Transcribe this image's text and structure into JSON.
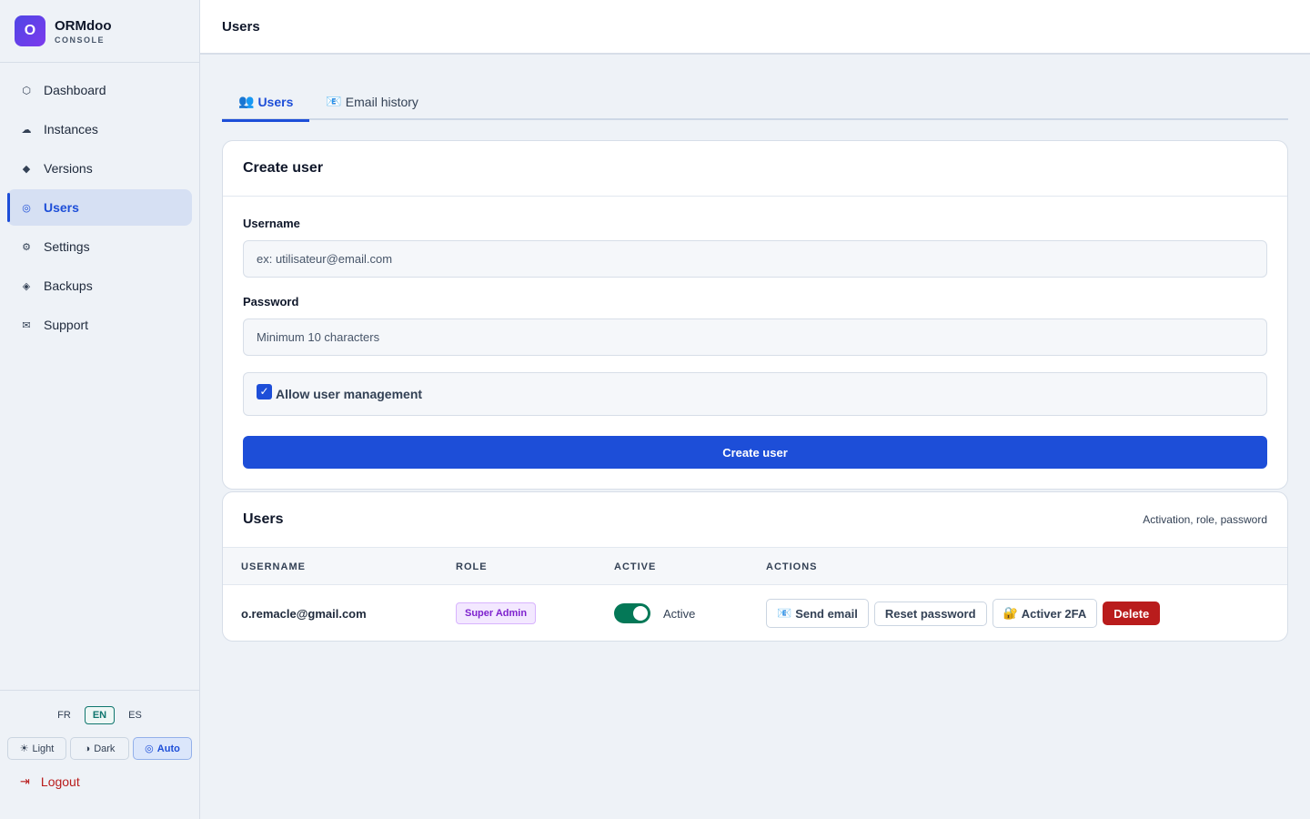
{
  "brand": {
    "logo_letter": "O",
    "name": "ORMdoo",
    "subtitle": "CONSOLE"
  },
  "sidebar": {
    "items": [
      {
        "label": "Dashboard",
        "icon": "dashboard-icon",
        "glyph": "⬡"
      },
      {
        "label": "Instances",
        "icon": "cloud-icon",
        "glyph": "☁"
      },
      {
        "label": "Versions",
        "icon": "diamond-icon",
        "glyph": "◆"
      },
      {
        "label": "Users",
        "icon": "user-circle-icon",
        "glyph": "◎",
        "active": true
      },
      {
        "label": "Settings",
        "icon": "gear-icon",
        "glyph": "⚙"
      },
      {
        "label": "Backups",
        "icon": "backup-icon",
        "glyph": "◈"
      },
      {
        "label": "Support",
        "icon": "mail-icon",
        "glyph": "✉"
      }
    ],
    "languages": [
      "FR",
      "EN",
      "ES"
    ],
    "active_language": "EN",
    "themes": [
      {
        "label": "Light",
        "glyph": "☀"
      },
      {
        "label": "Dark",
        "glyph": "◑"
      },
      {
        "label": "Auto",
        "glyph": "◎"
      }
    ],
    "active_theme": "Auto",
    "logout": {
      "label": "Logout",
      "glyph": "⇥"
    }
  },
  "header": {
    "title": "Users"
  },
  "tabs": [
    {
      "label": "Users",
      "glyph": "👥",
      "active": true
    },
    {
      "label": "Email history",
      "glyph": "📧"
    }
  ],
  "create_user": {
    "title": "Create user",
    "username_label": "Username",
    "username_placeholder": "ex: utilisateur@email.com",
    "password_label": "Password",
    "password_placeholder": "Minimum 10 characters",
    "allow_management_label": "Allow user management",
    "allow_management_checked": true,
    "submit_label": "Create user"
  },
  "users_table": {
    "title": "Users",
    "subtitle": "Activation, role, password",
    "columns": [
      "USERNAME",
      "ROLE",
      "ACTIVE",
      "ACTIONS"
    ],
    "rows": [
      {
        "username": "o.remacle@gmail.com",
        "role": "Super Admin",
        "active": true,
        "active_label": "Active",
        "actions": {
          "send_email": "Send email",
          "send_email_glyph": "📧",
          "reset_password": "Reset password",
          "activate_2fa": "Activer 2FA",
          "activate_2fa_glyph": "🔐",
          "delete": "Delete"
        }
      }
    ]
  },
  "colors": {
    "accent": "#1d4ed8",
    "danger": "#b91c1c",
    "success": "#047857",
    "badge_purple": "#7e22ce"
  }
}
